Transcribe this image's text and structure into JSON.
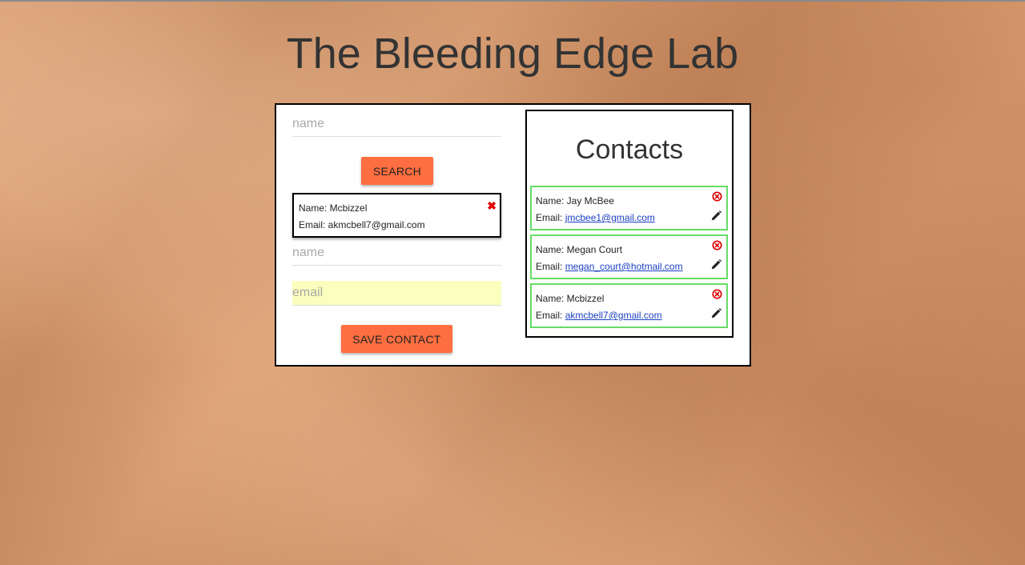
{
  "page": {
    "title": "The Bleeding Edge Lab"
  },
  "form": {
    "search_placeholder": "name",
    "search_button": "SEARCH",
    "search_result": {
      "name_line": "Name: Mcbizzel",
      "email_line": "Email: akmcbell7@gmail.com",
      "remove_icon": "red-x-icon"
    },
    "name_placeholder": "name",
    "email_placeholder": "email",
    "save_button": "SAVE CONTACT"
  },
  "contacts": {
    "title": "Contacts",
    "items": [
      {
        "name_label": "Name: Jay McBee",
        "email_label": "Email: ",
        "email": "jmcbee1@gmail.com"
      },
      {
        "name_label": "Name: Megan Court",
        "email_label": "Email: ",
        "email": "megan_court@hotmail.com"
      },
      {
        "name_label": "Name: Mcbizzel",
        "email_label": "Email: ",
        "email": "akmcbell7@gmail.com"
      }
    ],
    "delete_icon": "circle-x-icon",
    "edit_icon": "pencil-icon"
  },
  "colors": {
    "accent_button": "#ff6e40",
    "card_border": "#66dd66",
    "delete_red": "#e00000",
    "link": "#1a3fc1",
    "autofill_bg": "#faffbd"
  }
}
